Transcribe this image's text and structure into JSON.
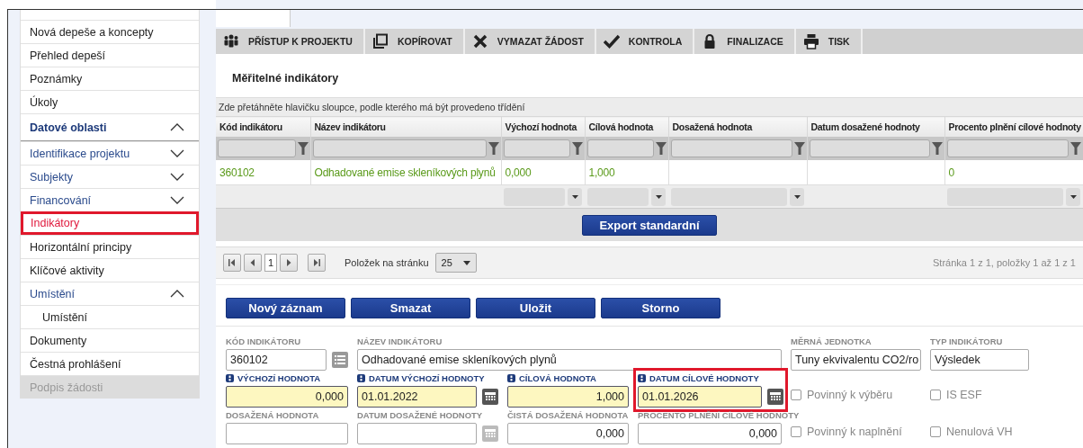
{
  "sidebar": {
    "items": [
      {
        "label": "Nová depeše a koncepty",
        "kind": "link",
        "selected": false,
        "disabled": false
      },
      {
        "label": "Přehled depeší",
        "kind": "link",
        "selected": false,
        "disabled": false
      },
      {
        "label": "Poznámky",
        "kind": "link",
        "selected": false,
        "disabled": false
      },
      {
        "label": "Úkoly",
        "kind": "link",
        "selected": false,
        "disabled": false
      },
      {
        "label": "Datové oblasti",
        "kind": "section",
        "expanded": true
      },
      {
        "label": "Identifikace projektu",
        "kind": "group",
        "expanded": false
      },
      {
        "label": "Subjekty",
        "kind": "group",
        "expanded": false
      },
      {
        "label": "Financování",
        "kind": "group",
        "expanded": false
      },
      {
        "label": "Indikátory",
        "kind": "link",
        "selected": true,
        "disabled": false
      },
      {
        "label": "Horizontální principy",
        "kind": "link",
        "selected": false,
        "disabled": false
      },
      {
        "label": "Klíčové aktivity",
        "kind": "link",
        "selected": false,
        "disabled": false
      },
      {
        "label": "Umístění",
        "kind": "group",
        "expanded": true,
        "children": [
          {
            "label": "Umístění",
            "kind": "link",
            "selected": false,
            "disabled": false
          }
        ]
      },
      {
        "label": "Dokumenty",
        "kind": "link",
        "selected": false,
        "disabled": false
      },
      {
        "label": "Čestná prohlášení",
        "kind": "link",
        "selected": false,
        "disabled": false
      },
      {
        "label": "Podpis žádosti",
        "kind": "link",
        "selected": false,
        "disabled": true
      }
    ]
  },
  "toolbar": [
    {
      "label": "PŘÍSTUP K PROJEKTU",
      "kind": "people"
    },
    {
      "label": "KOPÍROVAT",
      "kind": "copy"
    },
    {
      "label": "VYMAZAT ŽÁDOST",
      "kind": "delete"
    },
    {
      "label": "KONTROLA",
      "kind": "check"
    },
    {
      "label": "FINALIZACE",
      "kind": "lock"
    },
    {
      "label": "TISK",
      "kind": "print"
    }
  ],
  "section_title": "Měřitelné indikátory",
  "grid": {
    "group_hint": "Zde přetáhněte hlavičku sloupce, podle kterého má být provedeno třídění",
    "columns": [
      {
        "label": "Kód indikátoru",
        "aggregate": false
      },
      {
        "label": "Název indikátoru",
        "aggregate": false
      },
      {
        "label": "Výchozí hodnota",
        "aggregate": true
      },
      {
        "label": "Cílová hodnota",
        "aggregate": true
      },
      {
        "label": "Dosažená hodnota",
        "aggregate": true
      },
      {
        "label": "Datum dosažené hodnoty",
        "aggregate": false
      },
      {
        "label": "Procento plnění cílové hodnoty",
        "aggregate": true
      }
    ],
    "rows": [
      {
        "cells": [
          "360102",
          "Odhadované emise skleníkových plynů",
          "0,000",
          "1,000",
          null,
          null,
          "0"
        ]
      }
    ]
  },
  "export_button": "Export standardní",
  "pager": {
    "page": "1",
    "page_size_label": "Položek na stránku",
    "page_size": "25",
    "summary": "Stránka 1 z 1, položky 1 až 1 z 1"
  },
  "form_buttons": [
    "Nový záznam",
    "Smazat",
    "Uložit",
    "Storno"
  ],
  "form": {
    "fields": [
      {
        "kind": "code",
        "label": "KÓD INDIKÁTORU",
        "value": "360102",
        "required": false,
        "highlighted": false
      },
      {
        "kind": "wide",
        "label": "NÁZEV INDIKÁTORU",
        "value": "Odhadované emise skleníkových plynů",
        "required": false,
        "highlighted": false
      },
      {
        "kind": "text",
        "label": "MĚRNÁ JEDNOTKA",
        "value": "Tuny ekvivalentu CO2/ro",
        "required": false,
        "highlighted": false
      },
      {
        "kind": "text",
        "label": "TYP INDIKÁTORU",
        "value": "Výsledek",
        "required": false,
        "highlighted": false
      },
      {
        "kind": "number",
        "label": "VÝCHOZÍ HODNOTA",
        "value": "0,000",
        "required": true,
        "highlighted": false
      },
      {
        "kind": "date",
        "label": "DATUM VÝCHOZÍ HODNOTY",
        "value": "01.01.2022",
        "required": true,
        "highlighted": false,
        "disabled": false
      },
      {
        "kind": "number",
        "label": "CÍLOVÁ HODNOTA",
        "value": "1,000",
        "required": true,
        "highlighted": false
      },
      {
        "kind": "date",
        "label": "DATUM CÍLOVÉ HODNOTY",
        "value": "01.01.2026",
        "required": true,
        "highlighted": true,
        "disabled": false
      },
      {
        "kind": "checkbox",
        "label": "Povinný k výběru",
        "checked": false
      },
      {
        "kind": "checkbox",
        "label": "IS ESF",
        "checked": false
      },
      {
        "kind": "number",
        "label": "DOSAŽENÁ HODNOTA",
        "required": false,
        "highlighted": false
      },
      {
        "kind": "date",
        "label": "DATUM DOSAŽENÉ HODNOTY",
        "required": false,
        "highlighted": false,
        "disabled": true
      },
      {
        "kind": "number",
        "label": "ČISTÁ DOSAŽENÁ HODNOTA",
        "value": "0,000",
        "required": false,
        "highlighted": false
      },
      {
        "kind": "number",
        "label": "PROCENTO PLNĚNÍ CÍLOVÉ HODNOTY",
        "value": "0,000",
        "required": false,
        "highlighted": false
      },
      {
        "kind": "checkbox",
        "label": "Povinný k naplnění",
        "checked": false
      },
      {
        "kind": "checkbox",
        "label": "Nenulová VH",
        "checked": false
      }
    ]
  }
}
